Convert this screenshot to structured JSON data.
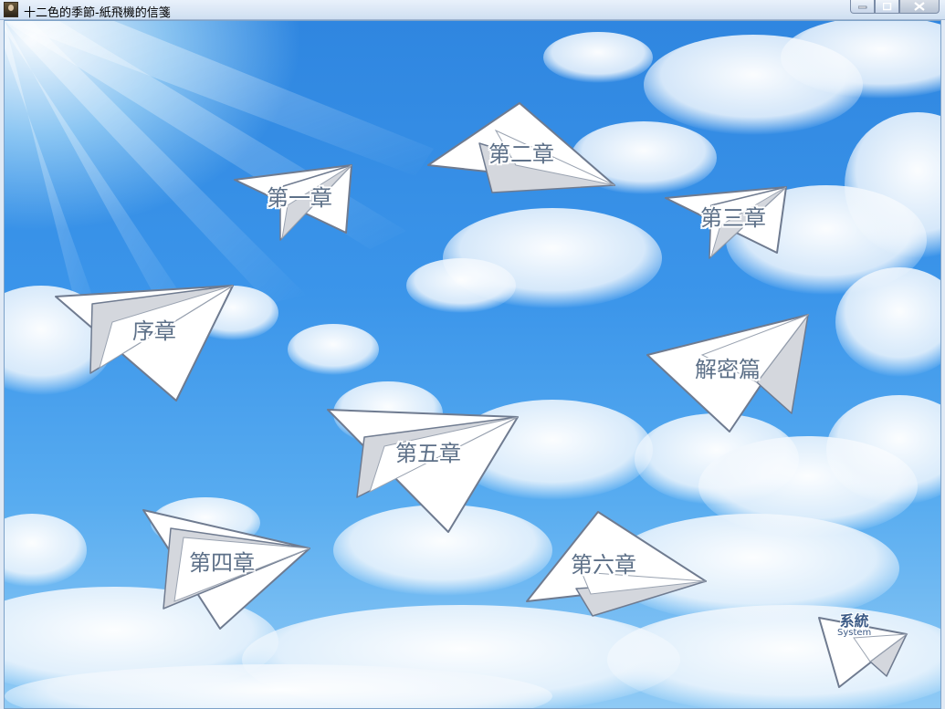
{
  "window": {
    "title": "十二色的季節-紙飛機的信箋"
  },
  "menu": {
    "chapters": [
      {
        "id": "prologue",
        "label": "序章"
      },
      {
        "id": "ch1",
        "label": "第一章"
      },
      {
        "id": "ch2",
        "label": "第二章"
      },
      {
        "id": "ch3",
        "label": "第三章"
      },
      {
        "id": "ch4",
        "label": "第四章"
      },
      {
        "id": "ch5",
        "label": "第五章"
      },
      {
        "id": "ch6",
        "label": "第六章"
      },
      {
        "id": "solution",
        "label": "解密篇"
      }
    ],
    "system": {
      "label": "系統",
      "sublabel": "System"
    }
  },
  "colors": {
    "sky_top": "#2f86e0",
    "sky_bottom": "#8fcaf5",
    "plane_fill": "#ffffff",
    "plane_shade": "#d4d7dd",
    "plane_outline": "#6f7b90",
    "label_color": "#5d7088"
  }
}
